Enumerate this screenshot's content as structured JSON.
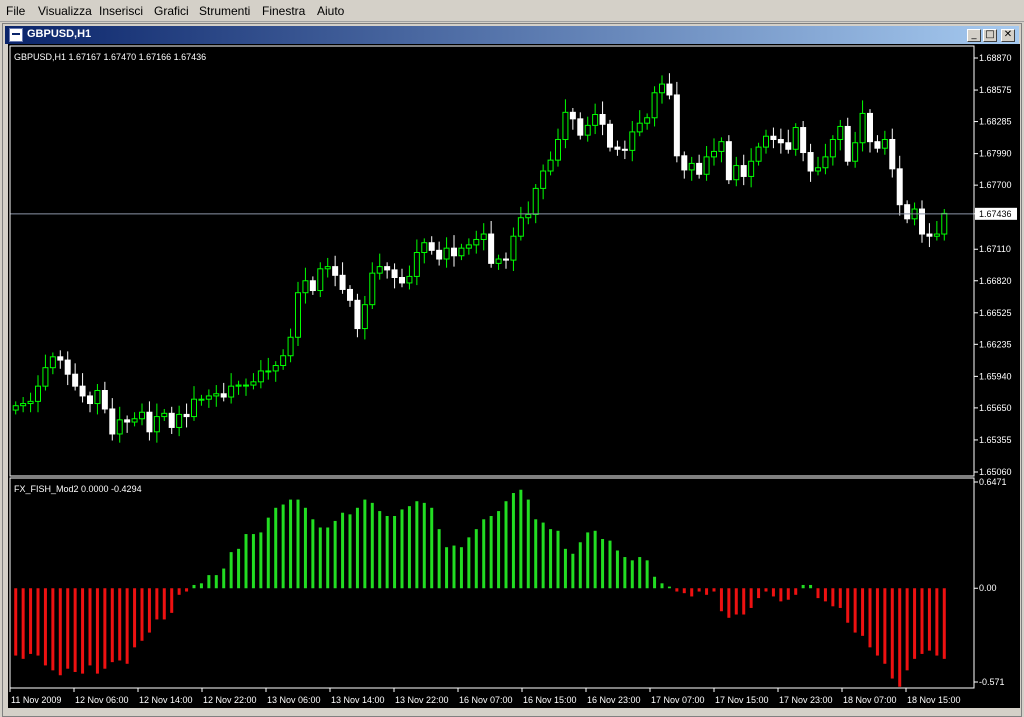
{
  "menu": [
    {
      "label": "File"
    },
    {
      "label": "Visualizza"
    },
    {
      "label": "Inserisci"
    },
    {
      "label": "Grafici"
    },
    {
      "label": "Strumenti"
    },
    {
      "label": "Finestra"
    },
    {
      "label": "Aiuto"
    }
  ],
  "window": {
    "title": "GBPUSD,H1",
    "minimize": "_",
    "maximize": "□",
    "close": "✕"
  },
  "colors": {
    "background": "#000000",
    "bull": "#00ff00",
    "bear": "#ffffff",
    "indicator_up": "#22dd22",
    "indicator_down": "#ee1111",
    "price_line": "#8c95a8",
    "text": "#ffffff"
  },
  "price_panel": {
    "info": "GBPUSD,H1  1.67167 1.67470 1.67166 1.67436",
    "axis_labels": [
      "1.68870",
      "1.68575",
      "1.68285",
      "1.67990",
      "1.67700",
      "1.67436",
      "1.67110",
      "1.66820",
      "1.66525",
      "1.66235",
      "1.65940",
      "1.65650",
      "1.65355",
      "1.65060"
    ],
    "current_price": "1.67436"
  },
  "indicator_panel": {
    "info": "FX_FISH_Mod2 0.0000 -0.4294",
    "axis_labels": [
      "0.6471",
      "0.00",
      "-0.571"
    ]
  },
  "time_axis": [
    "11 Nov 2009",
    "12 Nov 06:00",
    "12 Nov 14:00",
    "12 Nov 22:00",
    "13 Nov 06:00",
    "13 Nov 14:00",
    "13 Nov 22:00",
    "16 Nov 07:00",
    "16 Nov 15:00",
    "16 Nov 23:00",
    "17 Nov 07:00",
    "17 Nov 15:00",
    "17 Nov 23:00",
    "18 Nov 07:00",
    "18 Nov 15:00"
  ],
  "chart_data": {
    "type": "candlestick",
    "symbol": "GBPUSD",
    "timeframe": "H1",
    "ylim": [
      1.6506,
      1.6887
    ],
    "candles_close": [
      1.6567,
      1.6569,
      1.6571,
      1.6585,
      1.6602,
      1.6612,
      1.6609,
      1.6596,
      1.6585,
      1.6576,
      1.6569,
      1.6581,
      1.6564,
      1.6541,
      1.6554,
      1.6552,
      1.6555,
      1.6561,
      1.6543,
      1.6557,
      1.656,
      1.6547,
      1.6559,
      1.6557,
      1.6573,
      1.6573,
      1.6576,
      1.6578,
      1.6575,
      1.6585,
      1.6586,
      1.6586,
      1.6589,
      1.6599,
      1.6599,
      1.6604,
      1.6613,
      1.663,
      1.6671,
      1.6682,
      1.6673,
      1.6693,
      1.6695,
      1.6687,
      1.6674,
      1.6664,
      1.6638,
      1.666,
      1.6689,
      1.6695,
      1.6692,
      1.6685,
      1.668,
      1.6686,
      1.6708,
      1.6717,
      1.671,
      1.6702,
      1.6712,
      1.6705,
      1.6712,
      1.6715,
      1.672,
      1.6725,
      1.6698,
      1.6702,
      1.6701,
      1.6723,
      1.674,
      1.6743,
      1.6767,
      1.6783,
      1.6793,
      1.6812,
      1.6837,
      1.6831,
      1.6816,
      1.6825,
      1.6835,
      1.6826,
      1.6805,
      1.6803,
      1.6802,
      1.6819,
      1.6827,
      1.6832,
      1.6855,
      1.6863,
      1.6853,
      1.6797,
      1.6784,
      1.679,
      1.678,
      1.6796,
      1.6801,
      1.681,
      1.6775,
      1.6788,
      1.6778,
      1.6792,
      1.6805,
      1.6815,
      1.6812,
      1.6809,
      1.6803,
      1.6823,
      1.68,
      1.6783,
      1.6786,
      1.6796,
      1.6812,
      1.6824,
      1.6792,
      1.6809,
      1.6836,
      1.681,
      1.6804,
      1.6812,
      1.6785,
      1.6752,
      1.6739,
      1.6748,
      1.6725,
      1.6723,
      1.6725,
      1.6744
    ],
    "indicator_values": [
      -0.41,
      -0.43,
      -0.4,
      -0.41,
      -0.47,
      -0.5,
      -0.53,
      -0.49,
      -0.51,
      -0.52,
      -0.47,
      -0.52,
      -0.49,
      -0.45,
      -0.44,
      -0.46,
      -0.36,
      -0.32,
      -0.27,
      -0.19,
      -0.19,
      -0.15,
      -0.04,
      -0.02,
      0.02,
      0.03,
      0.08,
      0.08,
      0.12,
      0.22,
      0.24,
      0.33,
      0.33,
      0.34,
      0.43,
      0.49,
      0.51,
      0.54,
      0.54,
      0.49,
      0.42,
      0.37,
      0.37,
      0.41,
      0.46,
      0.45,
      0.49,
      0.54,
      0.52,
      0.47,
      0.44,
      0.44,
      0.48,
      0.5,
      0.53,
      0.52,
      0.49,
      0.36,
      0.25,
      0.26,
      0.25,
      0.31,
      0.36,
      0.42,
      0.44,
      0.47,
      0.53,
      0.58,
      0.6,
      0.54,
      0.42,
      0.4,
      0.36,
      0.35,
      0.24,
      0.21,
      0.28,
      0.34,
      0.35,
      0.3,
      0.29,
      0.23,
      0.19,
      0.17,
      0.19,
      0.17,
      0.07,
      0.03,
      0.01,
      -0.02,
      -0.03,
      -0.05,
      -0.02,
      -0.04,
      -0.02,
      -0.14,
      -0.18,
      -0.16,
      -0.16,
      -0.12,
      -0.06,
      -0.02,
      -0.05,
      -0.08,
      -0.07,
      -0.04,
      0.02,
      0.02,
      -0.06,
      -0.08,
      -0.11,
      -0.12,
      -0.21,
      -0.27,
      -0.29,
      -0.36,
      -0.41,
      -0.46,
      -0.55,
      -0.6,
      -0.5,
      -0.43,
      -0.4,
      -0.38,
      -0.41,
      -0.43
    ]
  }
}
